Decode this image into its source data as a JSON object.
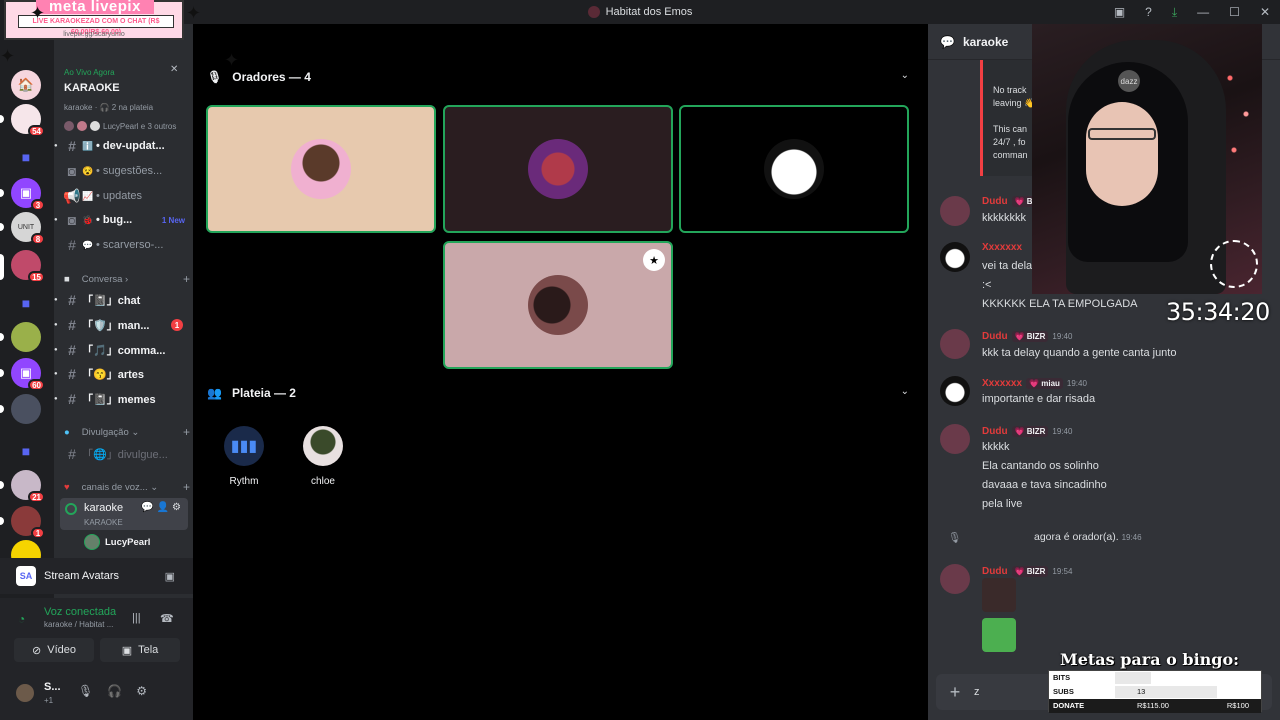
{
  "window": {
    "title": "Habitat dos Emos"
  },
  "rail": {
    "servers": [
      {
        "name": "home",
        "top": 0,
        "badge": ""
      },
      {
        "name": "server-2",
        "badge": "54"
      },
      {
        "name": "folder-1",
        "badge": ""
      },
      {
        "name": "twitch-1",
        "badge": "3"
      },
      {
        "name": "unit-gaming",
        "badge": "8"
      },
      {
        "name": "server-6",
        "badge": "15"
      },
      {
        "name": "folder-2",
        "badge": ""
      },
      {
        "name": "server-8",
        "badge": ""
      },
      {
        "name": "twitch-2",
        "badge": "60"
      },
      {
        "name": "server-10",
        "badge": ""
      },
      {
        "name": "folder-3",
        "badge": ""
      },
      {
        "name": "server-12",
        "badge": "21"
      },
      {
        "name": "server-13",
        "badge": "1"
      },
      {
        "name": "server-14",
        "badge": ""
      }
    ]
  },
  "livepix": {
    "title": "meta livepix",
    "message": "LIVE KARAOKEZAD COM O CHAT (R$ 60,00/R$ 60,00)",
    "url": "livepix.gg/scaryumo"
  },
  "event": {
    "live_label": "Ao Vivo Agora",
    "title": "KARAOKE",
    "channel": "karaoke",
    "audience": "2 na plateia",
    "participants": "LucyPearl e 3 outros"
  },
  "channels": [
    {
      "name": "• dev-updat...",
      "emoji": "ℹ️",
      "unread": true,
      "extra": ""
    },
    {
      "name": "• sugestões...",
      "emoji": "😵",
      "unread": false,
      "extra": ""
    },
    {
      "name": "• updates",
      "emoji": "📈",
      "unread": false,
      "extra": ""
    },
    {
      "name": "• bug...",
      "emoji": "🐞",
      "unread": true,
      "extra": "1 New"
    },
    {
      "name": "• scarverso-...",
      "emoji": "💬",
      "unread": false,
      "extra": ""
    }
  ],
  "categories": {
    "conversa": "Conversa",
    "divulgacao": "Divulgação",
    "voice": "canais de voz..."
  },
  "conversa_channels": [
    {
      "name": "「📓」chat",
      "count": ""
    },
    {
      "name": "「🛡️」man...",
      "count": "1"
    },
    {
      "name": "「🎵」comma...",
      "count": ""
    },
    {
      "name": "「😙」artes",
      "count": ""
    },
    {
      "name": "「📓」memes",
      "count": ""
    }
  ],
  "divulgacao_channel": "「🌐」divulgue...",
  "voice_channel": {
    "name": "karaoke",
    "sub": "KARAOKE",
    "user": "LucyPearl"
  },
  "stream_avatars": "Stream Avatars",
  "voice_connection": {
    "status": "Voz conectada",
    "location": "karaoke / Habitat ...",
    "video_label": "Vídeo",
    "screen_label": "Tela"
  },
  "user": {
    "name": "S...",
    "status": "+1"
  },
  "stage": {
    "speakers_title": "Oradores — 4",
    "audience_title": "Plateia — 2",
    "audience": [
      {
        "name": "Rythm"
      },
      {
        "name": "chloe"
      }
    ]
  },
  "chat": {
    "title": "karaoke",
    "embed_lines": [
      "No track",
      "leaving 👋",
      "",
      "This can",
      "24/7 , fo",
      "comman"
    ],
    "messages": [
      {
        "name": "Dudu",
        "tag": "💗 B",
        "time": "",
        "lines": [
          "kkkkkkkk"
        ]
      },
      {
        "name": "Xxxxxxx",
        "tag": "",
        "time": "",
        "lines": [
          "vei ta dela",
          ":<",
          "KKKKKK ELA TA EMPOLGADA"
        ]
      },
      {
        "name": "Dudu",
        "tag": "💗 BIZR",
        "time": "19:40",
        "lines": [
          "kkk ta delay quando a gente canta junto"
        ]
      },
      {
        "name": "Xxxxxxx",
        "tag": "💗 miau",
        "time": "19:40",
        "lines": [
          "importante e dar risada"
        ]
      },
      {
        "name": "Dudu",
        "tag": "💗 BIZR",
        "time": "19:40",
        "lines": [
          "kkkkk",
          "Ela cantando os solinho",
          "davaaa e tava sincadinho",
          "pela live"
        ]
      },
      {
        "name": "Dudu",
        "tag": "💗 BIZR",
        "time": "19:54",
        "lines": []
      }
    ],
    "system": {
      "text": "agora é orador(a).",
      "time": "19:46"
    },
    "composer_value": "z"
  },
  "overlay": {
    "cam_logo": "dazz",
    "timer": "35:34:20",
    "bingo_title": "Metas para o bingo:",
    "bingo": [
      {
        "label": "BITS",
        "value": "",
        "max": "",
        "progress": 0.3
      },
      {
        "label": "SUBS",
        "value": "13",
        "max": "",
        "progress": 0.85
      },
      {
        "label": "DONATE",
        "value": "R$115.00",
        "max": "R$100",
        "progress": 1.0
      }
    ]
  },
  "colors": {
    "accent": "#5865f2",
    "online": "#23a55a",
    "danger": "#f23f43"
  }
}
